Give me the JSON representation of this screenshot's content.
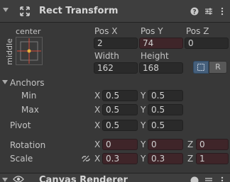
{
  "component": {
    "title": "Rect Transform"
  },
  "anchor_preset": {
    "horizontal_label": "center",
    "vertical_label": "middle"
  },
  "pos": {
    "x_label": "Pos X",
    "y_label": "Pos Y",
    "z_label": "Pos Z",
    "x_value": "2",
    "y_value": "74",
    "z_value": "0"
  },
  "size": {
    "width_label": "Width",
    "height_label": "Height",
    "width_value": "162",
    "height_value": "168"
  },
  "edit_mode": {
    "raw_label": "R"
  },
  "anchors": {
    "label": "Anchors",
    "min_label": "Min",
    "max_label": "Max",
    "min_x": "0.5",
    "min_y": "0.5",
    "max_x": "0.5",
    "max_y": "0.5"
  },
  "pivot": {
    "label": "Pivot",
    "x": "0.5",
    "y": "0.5"
  },
  "rotation": {
    "label": "Rotation",
    "x": "0",
    "y": "0",
    "z": "0"
  },
  "scale": {
    "label": "Scale",
    "x": "0.3",
    "y": "0.3",
    "z": "1"
  },
  "axis_labels": {
    "x": "X",
    "y": "Y",
    "z": "Z"
  },
  "next_component": {
    "title": "Canvas Renderer"
  },
  "colors": {
    "panel_bg": "#383838",
    "header_bg": "#3e3e3e",
    "field_bg": "#2a2a2a",
    "driven_field_bg": "#3f2529",
    "accent_blue": "#46607c",
    "anchor_red": "#d04a3a",
    "anchor_yellow": "#e8b13a"
  },
  "icons": {
    "fold": "triangle-down-icon",
    "component": "rect-transform-icon",
    "help": "help-icon",
    "preset": "sliders-icon",
    "menu": "kebab-menu-icon",
    "blueprint": "blueprint-icon",
    "constrain": "link-broken-icon",
    "eye": "eye-icon"
  }
}
